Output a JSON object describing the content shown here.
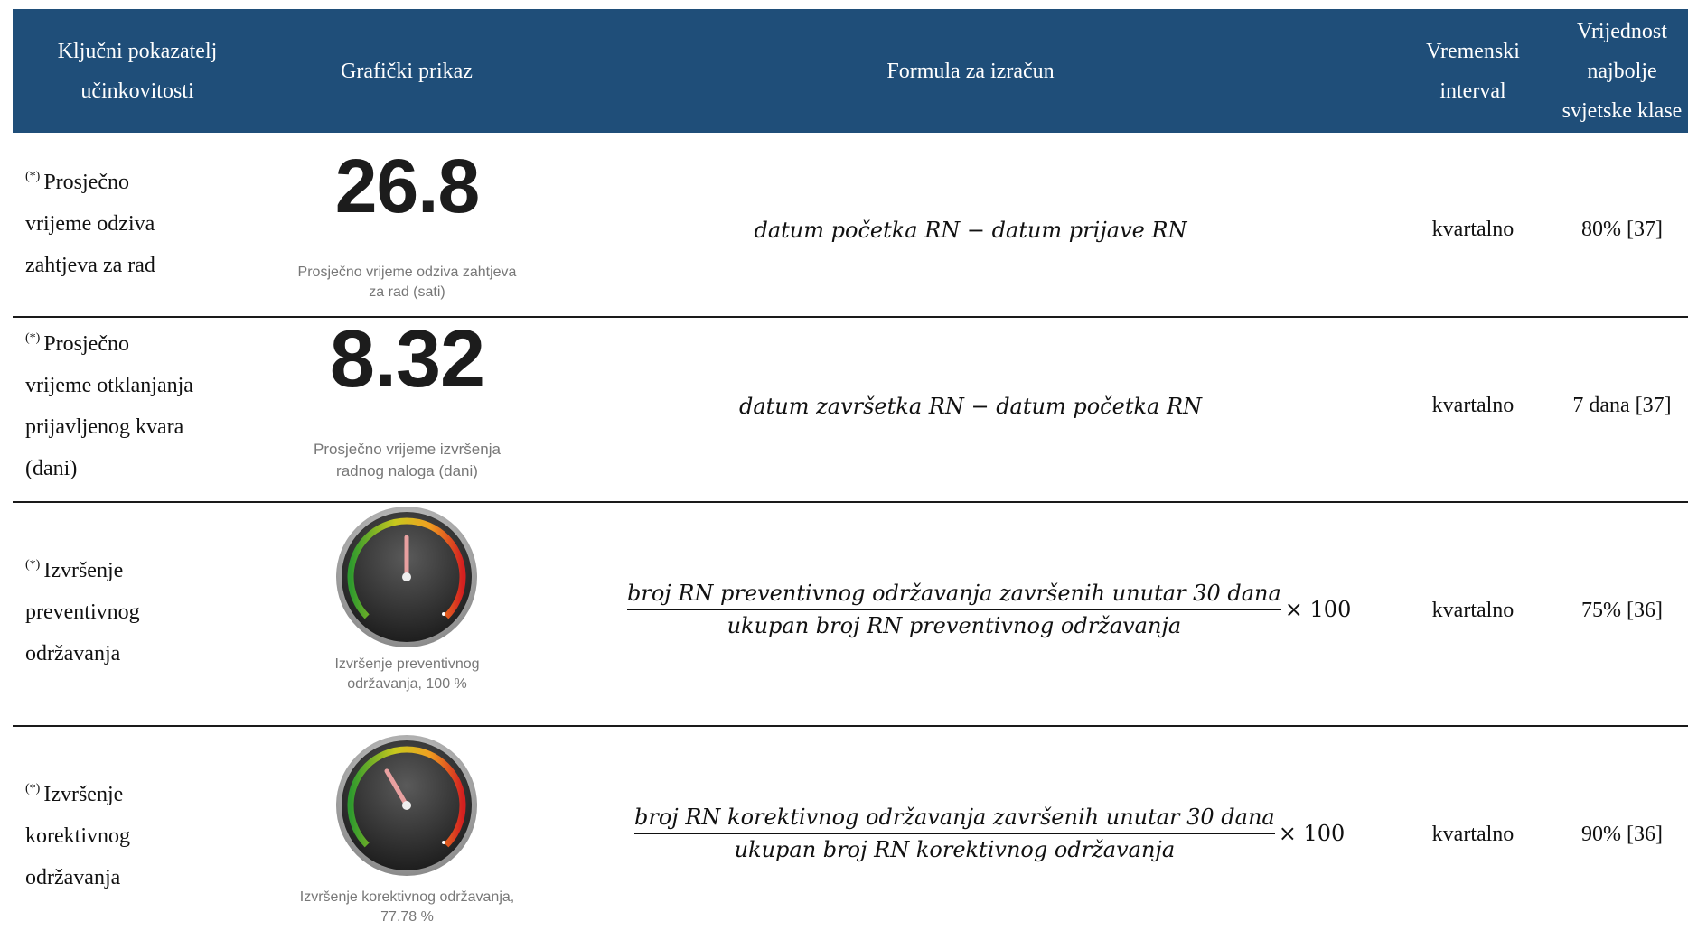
{
  "header": {
    "kpi": "Ključni pokazatelj\nučinkovitosti",
    "graphic": "Grafički prikaz",
    "formula": "Formula za izračun",
    "interval": "Vremenski\ninterval",
    "best": "Vrijednost\nnajbolje\nsvjetske klase"
  },
  "rows": [
    {
      "marker": "(*)",
      "kpi": "Prosječno\nvrijeme odziva\nzahtjeva za rad",
      "display_value": "26.8",
      "caption": "Prosječno vrijeme odziva zahtjeva\nza rad (sati)",
      "formula": "datum početka RN − datum prijave RN",
      "interval": "kvartalno",
      "best": "80% [37]"
    },
    {
      "marker": "(*)",
      "kpi": "Prosječno\nvrijeme otklanjanja\nprijavljenog kvara\n(dani)",
      "display_value": "8.32",
      "caption": "Prosječno vrijeme izvršenja\nradnog naloga (dani)",
      "formula": "datum završetka RN − datum početka RN",
      "interval": "kvartalno",
      "best": "7 dana [37]"
    },
    {
      "marker": "(*)",
      "kpi": "Izvršenje\npreventivnog\nodržavanja",
      "gauge_percent": 100,
      "caption": "Izvršenje preventivnog\nodržavanja, 100 %",
      "formula_num": "broj RN preventivnog održavanja završenih unutar 30 dana",
      "formula_den": "ukupan broj RN preventivnog održavanja",
      "formula_mult": "× 100",
      "interval": "kvartalno",
      "best": "75% [36]"
    },
    {
      "marker": "(*)",
      "kpi": "Izvršenje\nkorektivnog\nodržavanja",
      "gauge_percent": 77.78,
      "caption": "Izvršenje korektivnog održavanja,\n77.78 %",
      "formula_num": "broj RN korektivnog održavanja završenih unutar 30 dana",
      "formula_den": "ukupan broj RN korektivnog održavanja",
      "formula_mult": "× 100",
      "interval": "kvartalno",
      "best": "90% [36]"
    }
  ],
  "colors": {
    "header_bg": "#1f4e79",
    "header_text": "#ffffff",
    "gauge_body": "#3a3a3a",
    "gauge_needle": "#e8a0a0"
  },
  "icons": {
    "gauge": "speedometer-gauge-icon"
  }
}
